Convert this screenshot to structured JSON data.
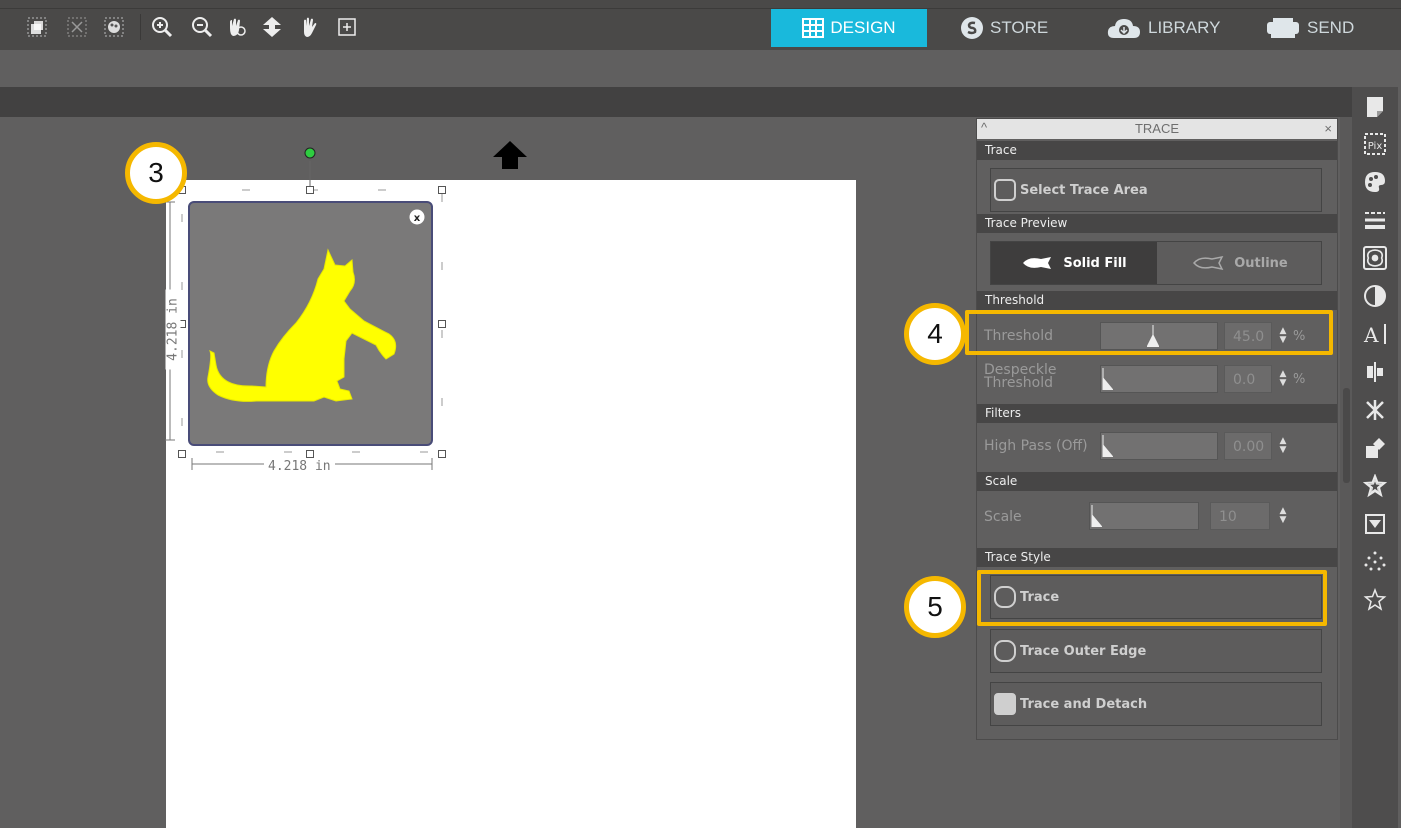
{
  "nav_tabs": {
    "design": "DESIGN",
    "store": "STORE",
    "library": "LIBRARY",
    "send": "SEND"
  },
  "accent_color": "#19b9dc",
  "highlight_color": "#f5b800",
  "trace_panel": {
    "title": "TRACE",
    "sections": {
      "trace": "Trace",
      "preview": "Trace Preview",
      "threshold": "Threshold",
      "filters": "Filters",
      "scale": "Scale",
      "style": "Trace Style"
    },
    "select_area": "Select Trace Area",
    "solid_fill": "Solid Fill",
    "outline": "Outline",
    "threshold_label": "Threshold",
    "threshold_value": "45.0",
    "threshold_unit": "%",
    "despeckle_label_1": "Despeckle",
    "despeckle_label_2": "Threshold",
    "despeckle_value": "0.0",
    "despeckle_unit": "%",
    "highpass_label": "High Pass (Off)",
    "highpass_value": "0.00",
    "scale_label": "Scale",
    "scale_value": "10",
    "trace_button": "Trace",
    "outer_edge_button": "Trace Outer Edge",
    "detach_button": "Trace and Detach"
  },
  "slider_levels": {
    "threshold": 0.45,
    "despeckle": 0.0,
    "highpass": 0.0,
    "scale": 0.0
  },
  "dimensions": {
    "width": "4.218 in",
    "height": "4.218 in"
  },
  "callouts": {
    "step3": "3",
    "step4": "4",
    "step5": "5"
  },
  "sidebar_icons": [
    "page-setup-icon",
    "pixscan-icon",
    "fill-color-icon",
    "line-style-icon",
    "trace-icon",
    "image-effects-icon",
    "text-icon",
    "align-icon",
    "replicate-icon",
    "transform-icon",
    "offset-icon",
    "modify-icon",
    "sketch-icon",
    "rhinestone-icon"
  ]
}
